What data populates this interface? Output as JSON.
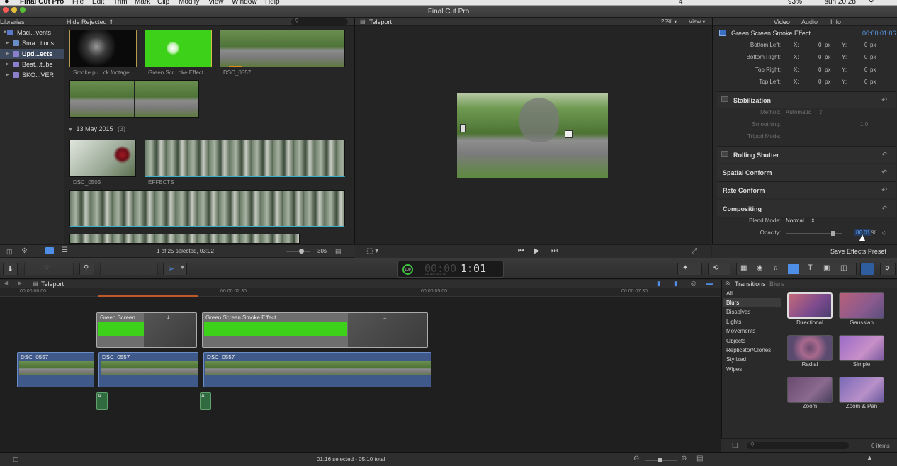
{
  "menubar": {
    "items": [
      "Final Cut Pro",
      "File",
      "Edit",
      "Trim",
      "Mark",
      "Clip",
      "Modify",
      "View",
      "Window",
      "Help"
    ],
    "battery": "93%",
    "clock": "sun 20:28",
    "extra": "4"
  },
  "window": {
    "title": "Final Cut Pro"
  },
  "libraries": {
    "header": "Libraries",
    "items": [
      "Maci...vents",
      "Sma...tions",
      "Upd...ects",
      "Beat...tube",
      "SKO...VER"
    ]
  },
  "browser": {
    "filter": "Hide Rejected",
    "clips": [
      "Smoke pu...ck footage",
      "Green Scr...oke Effect",
      "DSC_0557"
    ],
    "date_group": "13 May 2015",
    "date_count": "(3)",
    "clips2": [
      "DSC_0505",
      "EFFECTS"
    ],
    "status": "1 of 25 selected, 03:02",
    "duration": "30s"
  },
  "viewer": {
    "title": "Teleport",
    "zoom": "25%",
    "view_label": "View"
  },
  "inspector": {
    "tabs": [
      "Video",
      "Audio",
      "Info"
    ],
    "clip_name": "Green Screen Smoke Effect",
    "timecode": "00:00:01:06",
    "corners": [
      {
        "label": "Bottom Left:",
        "x": "0",
        "y": "0"
      },
      {
        "label": "Bottom Right:",
        "x": "0",
        "y": "0"
      },
      {
        "label": "Top Right:",
        "x": "0",
        "y": "0"
      },
      {
        "label": "Top Left:",
        "x": "0",
        "y": "0"
      }
    ],
    "x_label": "X:",
    "y_label": "Y:",
    "unit": "px",
    "stabilization": {
      "title": "Stabilization",
      "method_label": "Method:",
      "method_value": "Automatic",
      "smoothing_label": "Smoothing:",
      "smoothing_value": "1.0",
      "tripod_label": "Tripod Mode:"
    },
    "sections": [
      "Rolling Shutter",
      "Spatial Conform",
      "Rate Conform",
      "Compositing"
    ],
    "blend_label": "Blend Mode:",
    "blend_value": "Normal",
    "opacity_label": "Opacity:",
    "opacity_value": "86.01",
    "opacity_unit": "%",
    "save_preset": "Save Effects Preset"
  },
  "toolbar": {
    "timecode_display": "1:01",
    "timecode_pct": "100",
    "timecode_units": [
      "HR",
      "MIN",
      "SEC",
      "FR"
    ]
  },
  "timeline": {
    "project": "Teleport",
    "ruler": [
      "00:00:00:00",
      "00:00:02:30",
      "00:00:05:00",
      "00:00:07:30"
    ],
    "connected_clips": [
      "Green Screen...",
      "Green Screen Smoke Effect"
    ],
    "primary_clips": [
      "DSC_0557",
      "DSC_0557",
      "DSC_0557"
    ],
    "audio_labels": [
      "A...",
      "A..."
    ],
    "status": "01:16 selected - 05:10 total"
  },
  "transitions": {
    "title": "Transitions",
    "subtitle": "Blurs",
    "categories": [
      "All",
      "Blurs",
      "Dissolves",
      "Lights",
      "Movements",
      "Objects",
      "Replicator/Clones",
      "Stylized",
      "Wipes"
    ],
    "selected_category": "Blurs",
    "items": [
      "Directional",
      "Gaussian",
      "Radial",
      "Simple",
      "Zoom",
      "Zoom & Pan"
    ],
    "count": "6 items"
  },
  "colors": {
    "accent": "#4f8ee6",
    "green_screen": "#3ed11a",
    "connected_clip": "#6e6e6e",
    "primary_clip": "#3f5a8a"
  }
}
